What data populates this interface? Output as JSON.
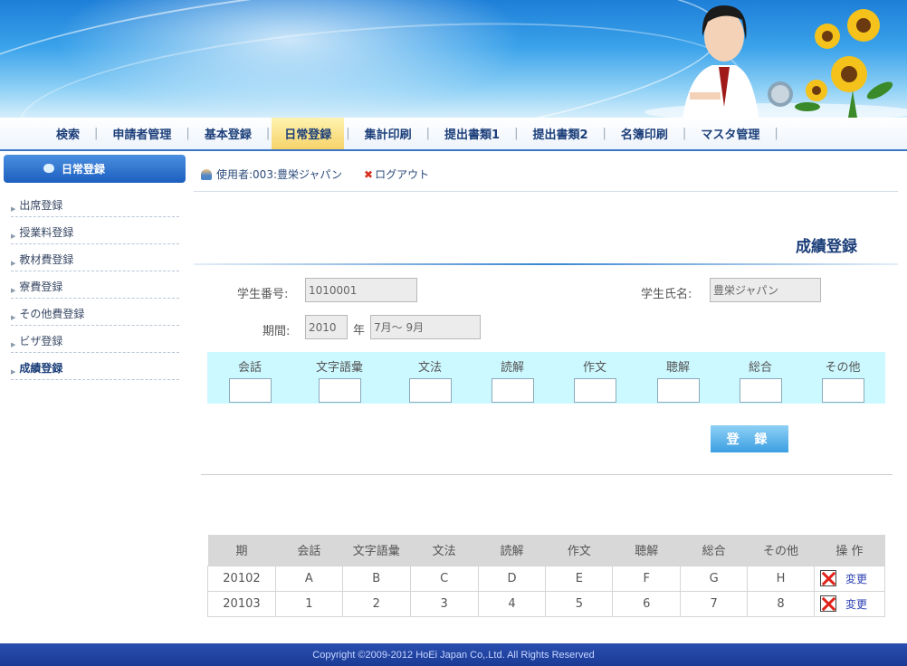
{
  "nav": {
    "items": [
      {
        "label": "検索"
      },
      {
        "label": "申請者管理"
      },
      {
        "label": "基本登録"
      },
      {
        "label": "日常登録"
      },
      {
        "label": "集計印刷"
      },
      {
        "label": "提出書類1"
      },
      {
        "label": "提出書類2"
      },
      {
        "label": "名簿印刷"
      },
      {
        "label": "マスタ管理"
      }
    ],
    "active_index": 3,
    "separator": "|"
  },
  "sidebar": {
    "header": "日常登録",
    "items": [
      {
        "label": "出席登録"
      },
      {
        "label": "授業料登録"
      },
      {
        "label": "教材費登録"
      },
      {
        "label": "寮費登録"
      },
      {
        "label": "その他費登録"
      },
      {
        "label": "ビザ登録"
      },
      {
        "label": "成績登録"
      }
    ],
    "active_index": 6
  },
  "userbar": {
    "user_text": "使用者:003:豊栄ジャパン",
    "logout_label": "ログアウト"
  },
  "form": {
    "title": "成績登録",
    "student_no_label": "学生番号:",
    "student_no_value": "1010001",
    "student_name_label": "学生氏名:",
    "student_name_value": "豊栄ジャパン",
    "period_label": "期間:",
    "year_value": "2010",
    "year_unit": "年",
    "term_value": "7月～ 9月",
    "grade_labels": [
      "会話",
      "文字語彙",
      "文法",
      "読解",
      "作文",
      "聴解",
      "総合",
      "その他"
    ],
    "submit_label": "登 録"
  },
  "table": {
    "headers": [
      "期",
      "会話",
      "文字語彙",
      "文法",
      "読解",
      "作文",
      "聴解",
      "総合",
      "その他",
      "操 作"
    ],
    "rows": [
      [
        "20102",
        "A",
        "B",
        "C",
        "D",
        "E",
        "F",
        "G",
        "H"
      ],
      [
        "20103",
        "1",
        "2",
        "3",
        "4",
        "5",
        "6",
        "7",
        "8"
      ]
    ],
    "edit_label": "変更"
  },
  "footer": {
    "copyright": "Copyright ©2009-2012 HoEi Japan Co,.Ltd. All Rights Reserved"
  },
  "colors": {
    "accent": "#1c3f7a",
    "nav_active": "#f6d36a",
    "grade_band": "#ccf8ff",
    "delete_red": "#e0241b"
  }
}
